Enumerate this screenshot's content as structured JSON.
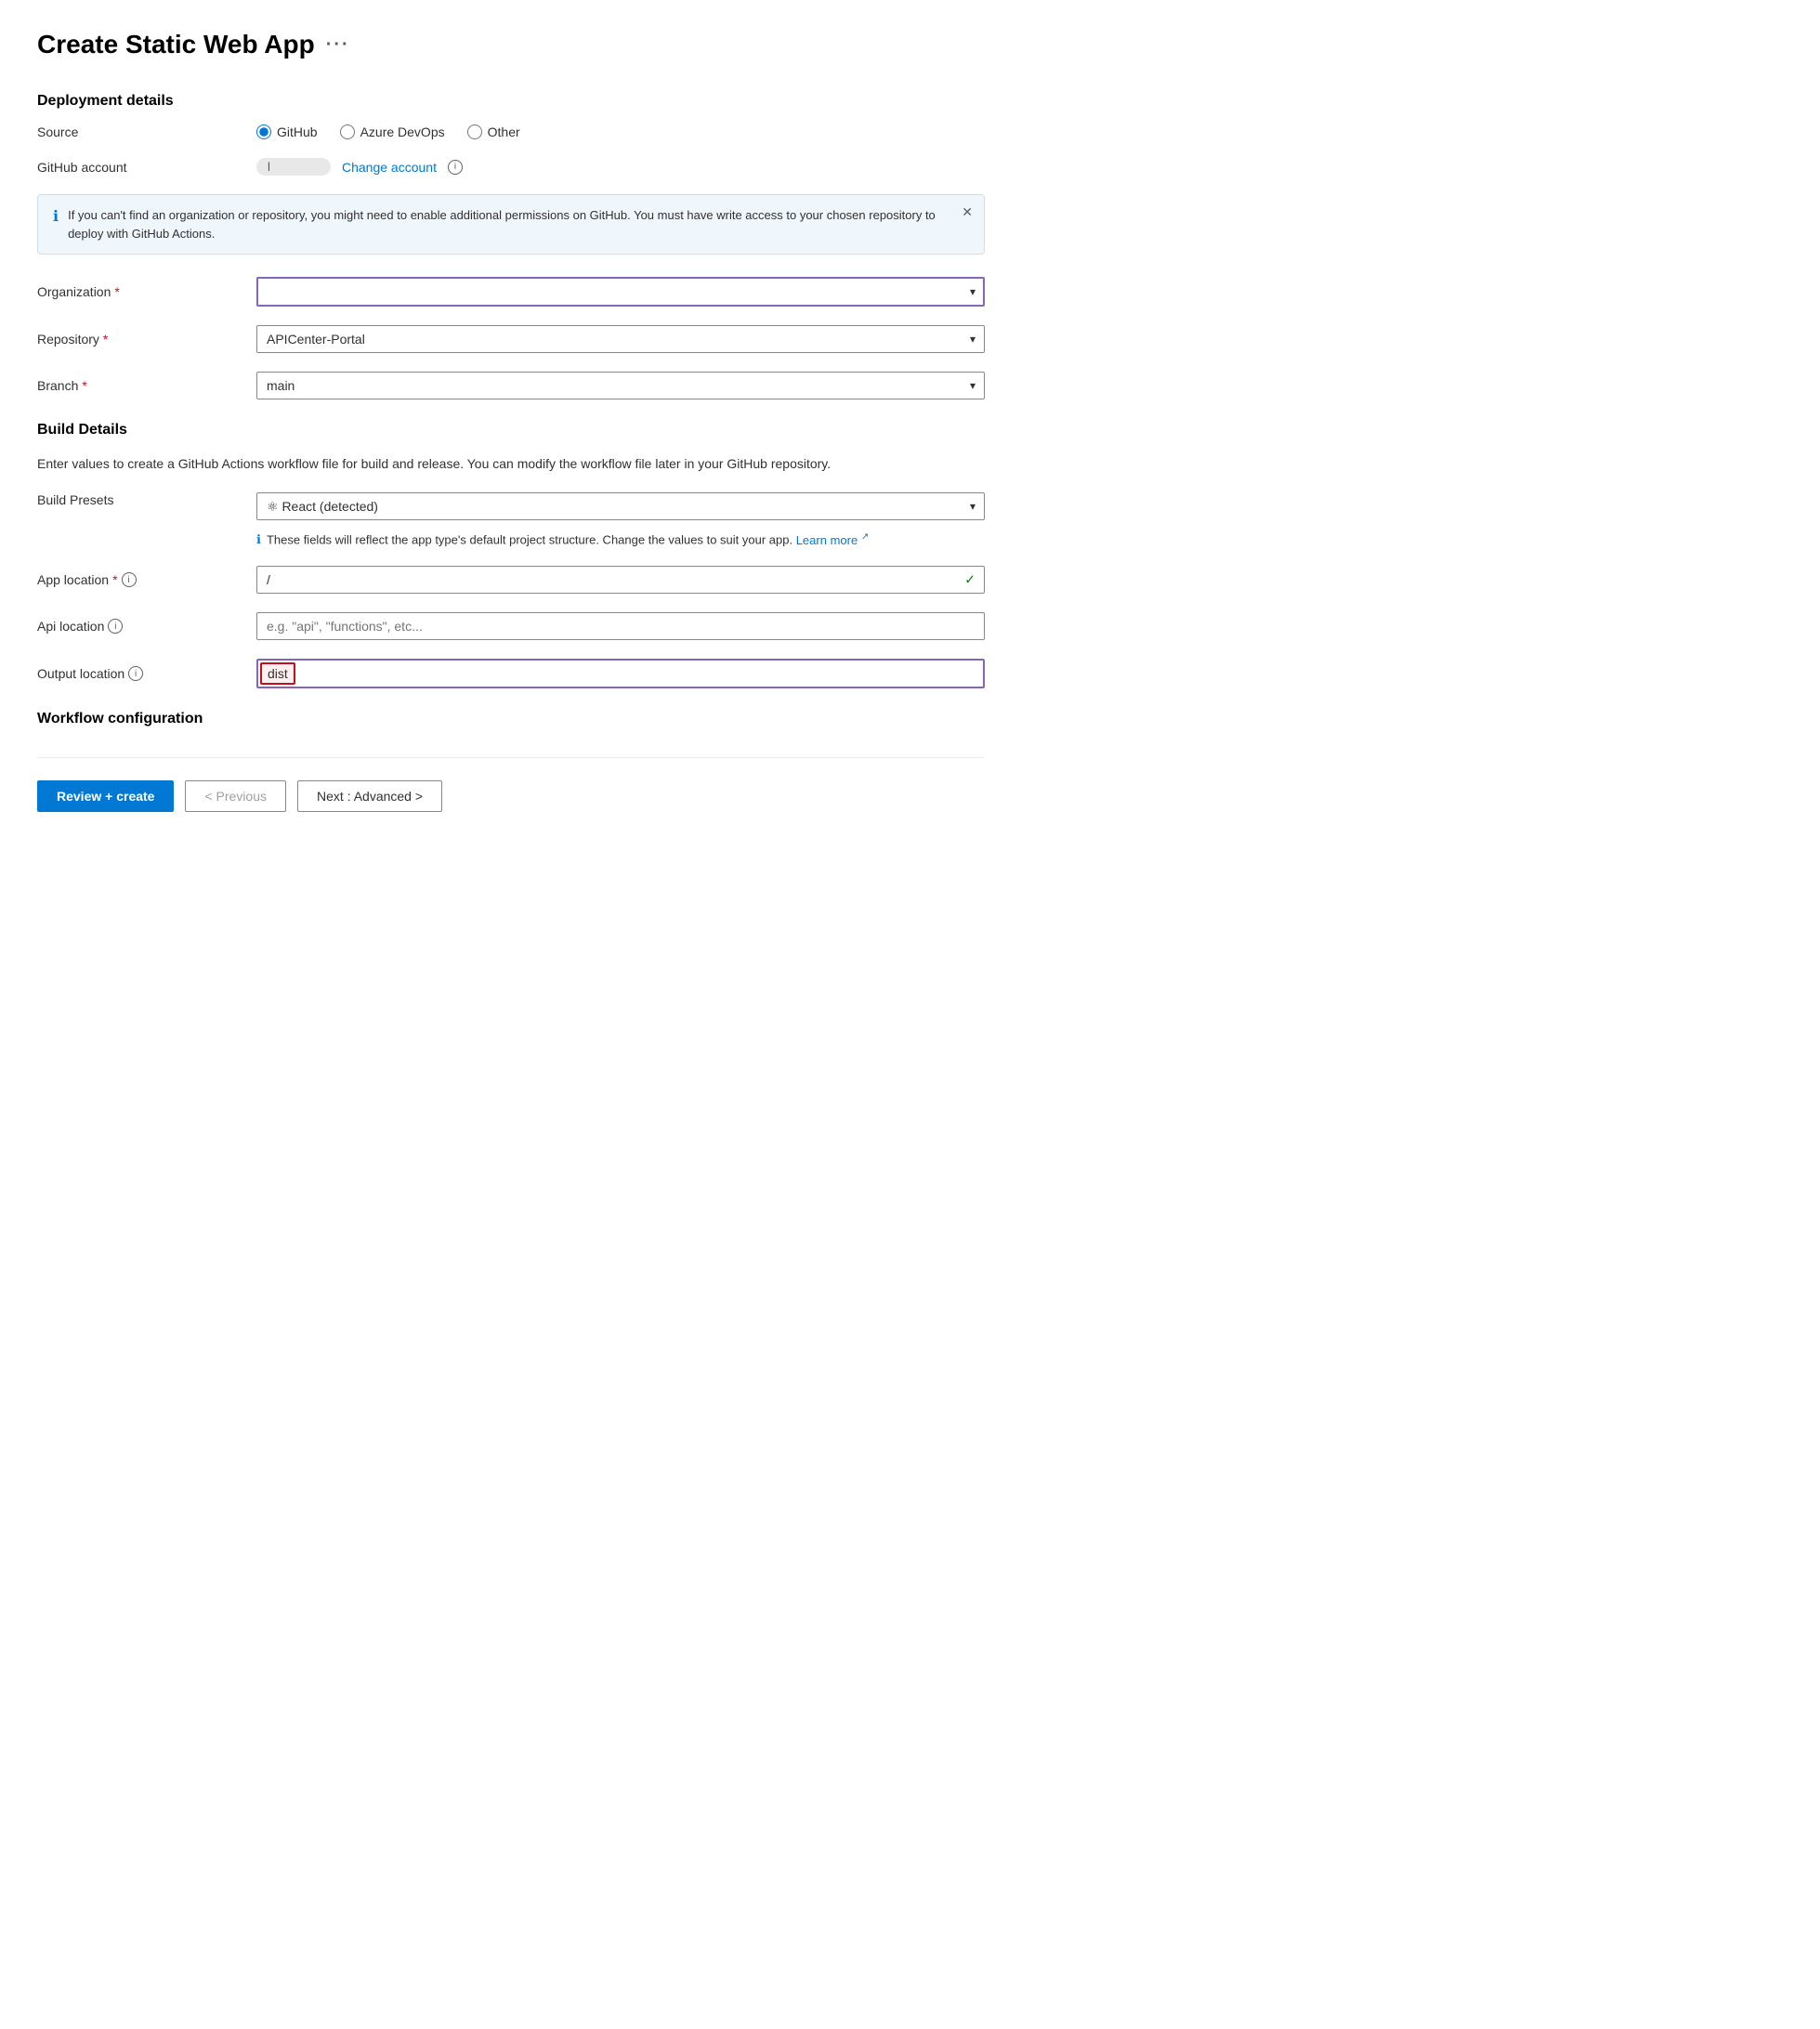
{
  "page": {
    "title": "Create Static Web App",
    "ellipsis": "···"
  },
  "deployment": {
    "section_title": "Deployment details",
    "source_label": "Source",
    "source_options": [
      {
        "id": "github",
        "label": "GitHub",
        "checked": true
      },
      {
        "id": "azure-devops",
        "label": "Azure DevOps",
        "checked": false
      },
      {
        "id": "other",
        "label": "Other",
        "checked": false
      }
    ],
    "github_account_label": "GitHub account",
    "github_account_value": "l",
    "change_account_label": "Change account",
    "info_banner_text": "If you can't find an organization or repository, you might need to enable additional permissions on GitHub. You must have write access to your chosen repository to deploy with GitHub Actions.",
    "org_label": "Organization",
    "org_value": "",
    "org_placeholder": "",
    "repo_label": "Repository",
    "repo_value": "APICenter-Portal",
    "branch_label": "Branch",
    "branch_value": "main"
  },
  "build": {
    "section_title": "Build Details",
    "description": "Enter values to create a GitHub Actions workflow file for build and release. You can modify the workflow file later in your GitHub repository.",
    "presets_label": "Build Presets",
    "presets_value": "React (detected)",
    "presets_info": "These fields will reflect the app type's default project structure. Change the values to suit your app.",
    "learn_more": "Learn more",
    "app_location_label": "App location",
    "app_location_value": "/",
    "api_location_label": "Api location",
    "api_location_placeholder": "e.g. \"api\", \"functions\", etc...",
    "output_location_label": "Output location",
    "output_location_value": "dist"
  },
  "workflow": {
    "section_title": "Workflow configuration"
  },
  "footer": {
    "review_create": "Review + create",
    "previous": "< Previous",
    "next_advanced": "Next : Advanced >"
  }
}
